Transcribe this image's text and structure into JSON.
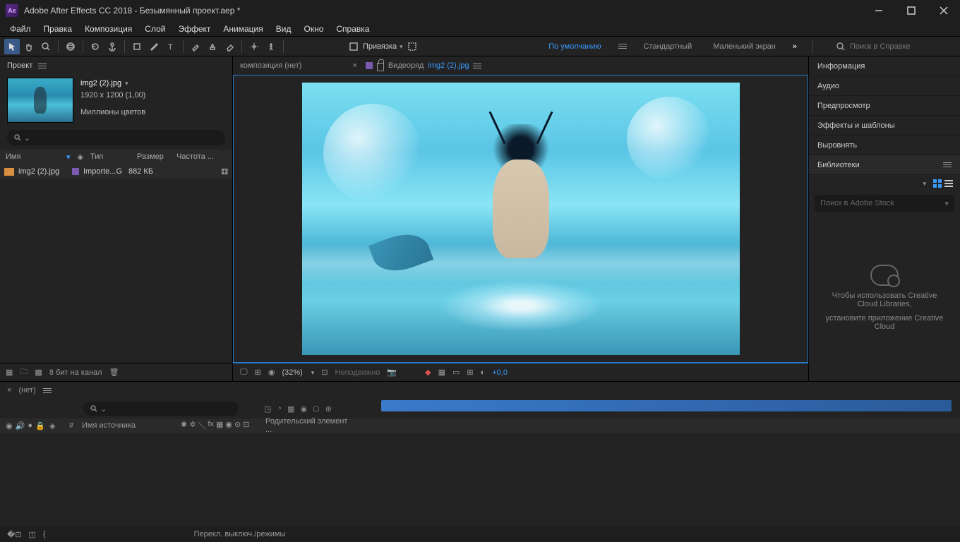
{
  "titlebar": {
    "app": "Adobe After Effects CC 2018 - Безымянный проект.aep *"
  },
  "menu": [
    "Файл",
    "Правка",
    "Композиция",
    "Слой",
    "Эффект",
    "Анимация",
    "Вид",
    "Окно",
    "Справка"
  ],
  "toolbar": {
    "snap": "Привязка"
  },
  "workspaces": {
    "default": "По умолчанию",
    "standard": "Стандартный",
    "small": "Маленький экран"
  },
  "search": {
    "placeholder": "Поиск в Справке"
  },
  "project": {
    "title": "Проект",
    "asset": {
      "name": "img2 (2).jpg",
      "dims": "1920 x 1200 (1,00)",
      "colors": "Миллионы цветов"
    },
    "cols": {
      "name": "Имя",
      "type": "Тип",
      "size": "Размер",
      "rate": "Частота ..."
    },
    "row": {
      "name": "img2 (2).jpg",
      "type": "Importe...G",
      "size": "882 КБ"
    },
    "bpc": "8 бит на канал"
  },
  "viewer": {
    "comp_none": "композиция (нет)",
    "footage": "Видеоряд",
    "footage_name": "img2 (2).jpg",
    "zoom": "(32%)",
    "still": "Неподвижно",
    "plus": "+0,0"
  },
  "rightPanels": [
    "Информация",
    "Аудио",
    "Предпросмотр",
    "Эффекты и шаблоны",
    "Выровнять",
    "Библиотеки"
  ],
  "lib": {
    "stock": "Поиск в Adobe Stock",
    "msg1": "Чтобы использовать Creative Cloud Libraries,",
    "msg2": "установите приложение Creative Cloud"
  },
  "timeline": {
    "none": "(нет)",
    "time": "",
    "cols": {
      "src": "Имя источника",
      "parent": "Родительский элемент ..."
    },
    "hash": "#",
    "toggle": "Перекл. выключ./режимы"
  }
}
